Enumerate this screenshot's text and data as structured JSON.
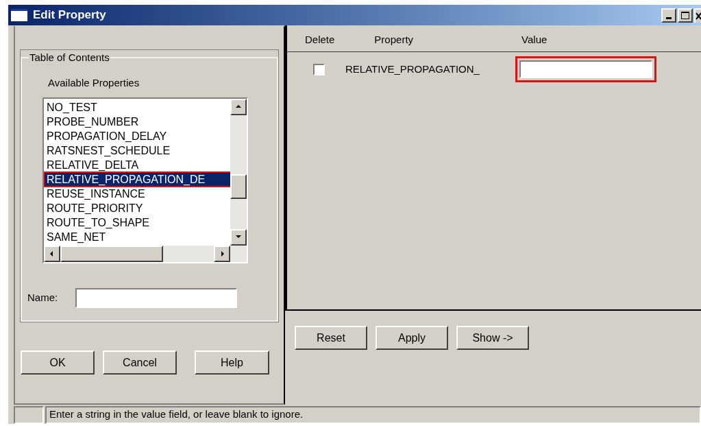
{
  "window": {
    "title": "Edit Property"
  },
  "table_of_contents": {
    "legend": "Table of Contents",
    "list_label": "Available Properties",
    "items": [
      {
        "label": "NO_TEST",
        "selected": false
      },
      {
        "label": "PROBE_NUMBER",
        "selected": false
      },
      {
        "label": "PROPAGATION_DELAY",
        "selected": false
      },
      {
        "label": "RATSNEST_SCHEDULE",
        "selected": false
      },
      {
        "label": "RELATIVE_DELTA",
        "selected": false
      },
      {
        "label": "RELATIVE_PROPAGATION_DE",
        "selected": true,
        "highlighted": true
      },
      {
        "label": "REUSE_INSTANCE",
        "selected": false
      },
      {
        "label": "ROUTE_PRIORITY",
        "selected": false
      },
      {
        "label": "ROUTE_TO_SHAPE",
        "selected": false
      },
      {
        "label": "SAME_NET",
        "selected": false
      }
    ],
    "name_label": "Name:"
  },
  "left_buttons": [
    "OK",
    "Cancel",
    "Help"
  ],
  "properties": {
    "columns": [
      "Delete",
      "Property",
      "Value"
    ],
    "rows": [
      {
        "delete": false,
        "property": "RELATIVE_PROPAGATION_",
        "value_highlighted": true
      }
    ]
  },
  "right_buttons": [
    "Reset",
    "Apply",
    "Show ->"
  ],
  "status_bar": "Enter a string in the value field, or leave blank to ignore."
}
